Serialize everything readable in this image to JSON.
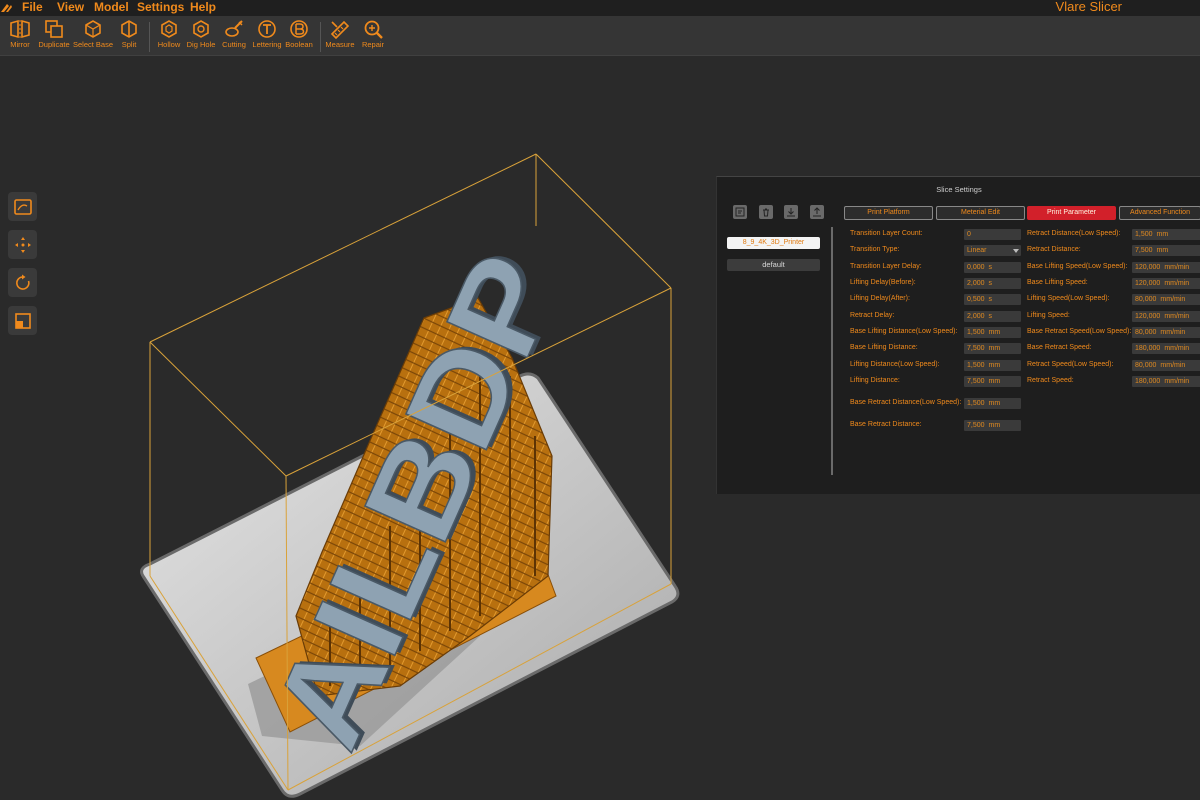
{
  "app": {
    "title": "Vlare Slicer"
  },
  "menu": {
    "items": [
      "File",
      "View",
      "Model",
      "Settings",
      "Help"
    ]
  },
  "toolbar": {
    "tools": [
      {
        "label": "Mirror",
        "icon": "mirror-icon"
      },
      {
        "label": "Duplicate",
        "icon": "duplicate-icon"
      },
      {
        "label": "Select Base",
        "icon": "select-base-icon"
      },
      {
        "label": "Split",
        "icon": "split-icon"
      },
      {
        "label": "Hollow",
        "icon": "hollow-icon"
      },
      {
        "label": "Dig Hole",
        "icon": "dig-hole-icon"
      },
      {
        "label": "Cutting",
        "icon": "cutting-icon"
      },
      {
        "label": "Lettering",
        "icon": "lettering-icon"
      },
      {
        "label": "Boolean",
        "icon": "boolean-icon"
      },
      {
        "label": "Measure",
        "icon": "measure-icon"
      },
      {
        "label": "Repair",
        "icon": "repair-icon"
      }
    ]
  },
  "sidebar": {
    "buttons": [
      {
        "icon": "view-reset-icon"
      },
      {
        "icon": "move-icon"
      },
      {
        "icon": "rotate-icon"
      },
      {
        "icon": "scale-icon"
      }
    ]
  },
  "model": {
    "text": "AILBDP"
  },
  "colors": {
    "accent": "#f08a1c",
    "active_tab": "#d2202a",
    "model": "#8ea2b2",
    "supports": "#d7891f",
    "plate": "#d8d8d8"
  },
  "settings": {
    "title": "Slice Settings",
    "icons": [
      "import-profile-icon",
      "delete-icon",
      "download-icon",
      "export-icon"
    ],
    "printer": "8_9_4K_3D_Printer",
    "profile": "default",
    "tabs": [
      {
        "label": "Print Platform",
        "active": false
      },
      {
        "label": "Meterial Edit",
        "active": false
      },
      {
        "label": "Print Parameter",
        "active": true
      },
      {
        "label": "Advanced Function",
        "active": false
      }
    ],
    "left_params": [
      {
        "label": "Transition Layer Count:",
        "value": "0",
        "unit": ""
      },
      {
        "label": "Transition Type:",
        "value": "Linear",
        "unit": "",
        "dropdown": true
      },
      {
        "label": "Transition Layer Delay:",
        "value": "0,000",
        "unit": "s"
      },
      {
        "label": "Lifting Delay(Before):",
        "value": "2,000",
        "unit": "s"
      },
      {
        "label": "Lifting Delay(After):",
        "value": "0,500",
        "unit": "s"
      },
      {
        "label": "Retract Delay:",
        "value": "2,000",
        "unit": "s"
      },
      {
        "label": "Base Lifting Distance(Low Speed):",
        "value": "1,500",
        "unit": "mm"
      },
      {
        "label": "Base Lifting Distance:",
        "value": "7,500",
        "unit": "mm"
      },
      {
        "label": "Lifting Distance(Low Speed):",
        "value": "1,500",
        "unit": "mm"
      },
      {
        "label": "Lifting Distance:",
        "value": "7,500",
        "unit": "mm"
      },
      {
        "label": "Base Retract Distance(Low Speed):",
        "value": "1,500",
        "unit": "mm"
      },
      {
        "label": "Base Retract Distance:",
        "value": "7,500",
        "unit": "mm"
      }
    ],
    "right_params": [
      {
        "label": "Retract Distance(Low Speed):",
        "value": "1,500",
        "unit": "mm"
      },
      {
        "label": "Retract Distance:",
        "value": "7,500",
        "unit": "mm"
      },
      {
        "label": "Base Lifting Speed(Low Speed):",
        "value": "120,000",
        "unit": "mm/min"
      },
      {
        "label": "Base Lifting Speed:",
        "value": "120,000",
        "unit": "mm/min"
      },
      {
        "label": "Lifting Speed(Low Speed):",
        "value": "80,000",
        "unit": "mm/min"
      },
      {
        "label": "Lifting Speed:",
        "value": "120,000",
        "unit": "mm/min"
      },
      {
        "label": "Base Retract Speed(Low Speed):",
        "value": "80,000",
        "unit": "mm/min"
      },
      {
        "label": "Base Retract Speed:",
        "value": "180,000",
        "unit": "mm/min"
      },
      {
        "label": "Retract Speed(Low Speed):",
        "value": "80,000",
        "unit": "mm/min"
      },
      {
        "label": "Retract Speed:",
        "value": "180,000",
        "unit": "mm/min"
      }
    ]
  }
}
